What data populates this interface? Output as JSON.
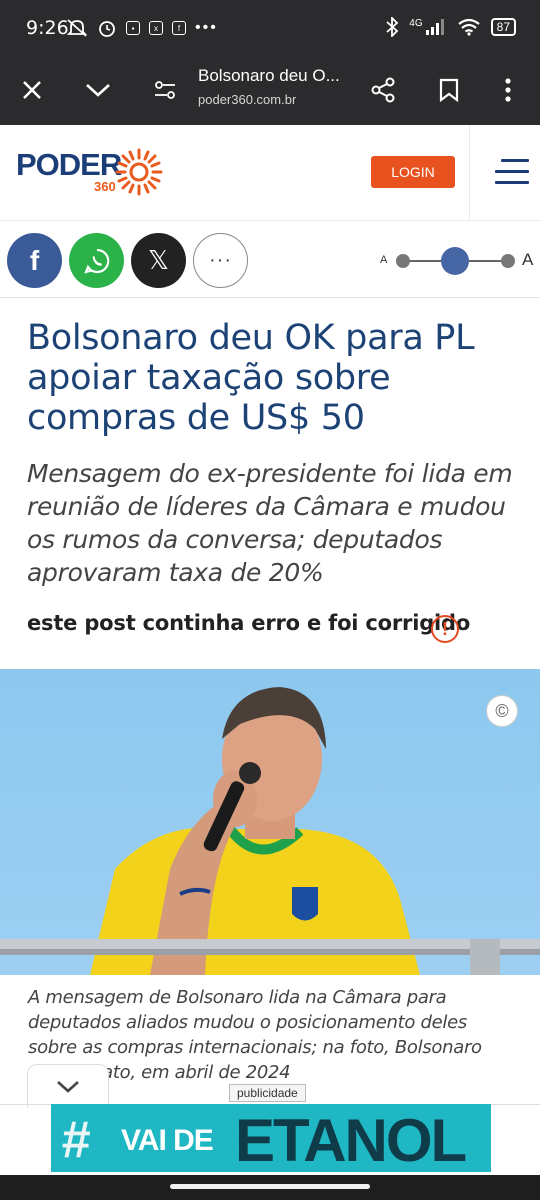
{
  "status_bar": {
    "time": "9:26",
    "notification_icons": [
      "mute-icon",
      "alarm-icon",
      "app-icon",
      "x-app-icon",
      "facebook-app-icon"
    ],
    "overflow": "•••",
    "network": "4G",
    "battery": "87"
  },
  "browser": {
    "page_title": "Bolsonaro deu O...",
    "url": "poder360.com.br"
  },
  "site": {
    "logo_text": "PODER",
    "logo_sub": "360",
    "login_label": "LOGIN"
  },
  "share": {
    "facebook_glyph": "f",
    "x_glyph": "𝕏",
    "more_glyph": "···",
    "font_small_label": "A",
    "font_large_label": "A"
  },
  "article": {
    "headline": "Bolsonaro deu OK para PL apoiar taxação sobre compras de US$ 50",
    "subheadline": "Mensagem do ex-presidente foi lida em reunião de líderes da Câmara e mudou os rumos da conversa; deputados aprovaram taxa de 20%",
    "correction_notice": "este post continha erro e foi corrigido",
    "correction_icon": "!",
    "copyright_icon": "©",
    "photo_caption": "A mensagem de Bolsonaro lida na Câmara para deputados aliados mudou o posicionamento deles sobre as compras internacionais; na foto, Bolsonaro durante ato, em abril de 2024"
  },
  "ad": {
    "label": "publicidade",
    "hash": "#",
    "text_1": "VAI DE",
    "text_2": "ETANOL"
  },
  "colors": {
    "brand_blue": "#1d4376",
    "brand_orange": "#e8521f",
    "facebook": "#3a5a98",
    "whatsapp": "#2bb34a"
  }
}
